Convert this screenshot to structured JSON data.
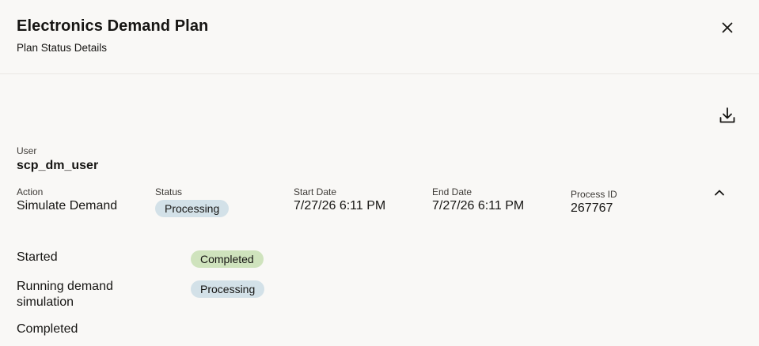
{
  "header": {
    "title": "Electronics Demand Plan",
    "subtitle": "Plan Status Details"
  },
  "icons": {
    "close": "close-icon",
    "download": "download-icon",
    "collapse": "chevron-up-icon"
  },
  "user": {
    "label": "User",
    "value": "scp_dm_user"
  },
  "summary": {
    "action_label": "Action",
    "action_value": "Simulate Demand",
    "status_label": "Status",
    "status_value": "Processing",
    "start_label": "Start Date",
    "start_value": "7/27/26 6:11 PM",
    "end_label": "End Date",
    "end_value": "7/27/26 6:11 PM",
    "process_label": "Process ID",
    "process_value": "267767"
  },
  "steps": [
    {
      "label": "Started",
      "status": "Completed"
    },
    {
      "label": "Running demand simulation",
      "status": "Processing"
    },
    {
      "label": "Completed",
      "status": ""
    }
  ],
  "colors": {
    "background": "#f9f8f6",
    "processing_badge": "#d3e1e8",
    "completed_badge": "#cfe3bd",
    "text": "#161513"
  }
}
